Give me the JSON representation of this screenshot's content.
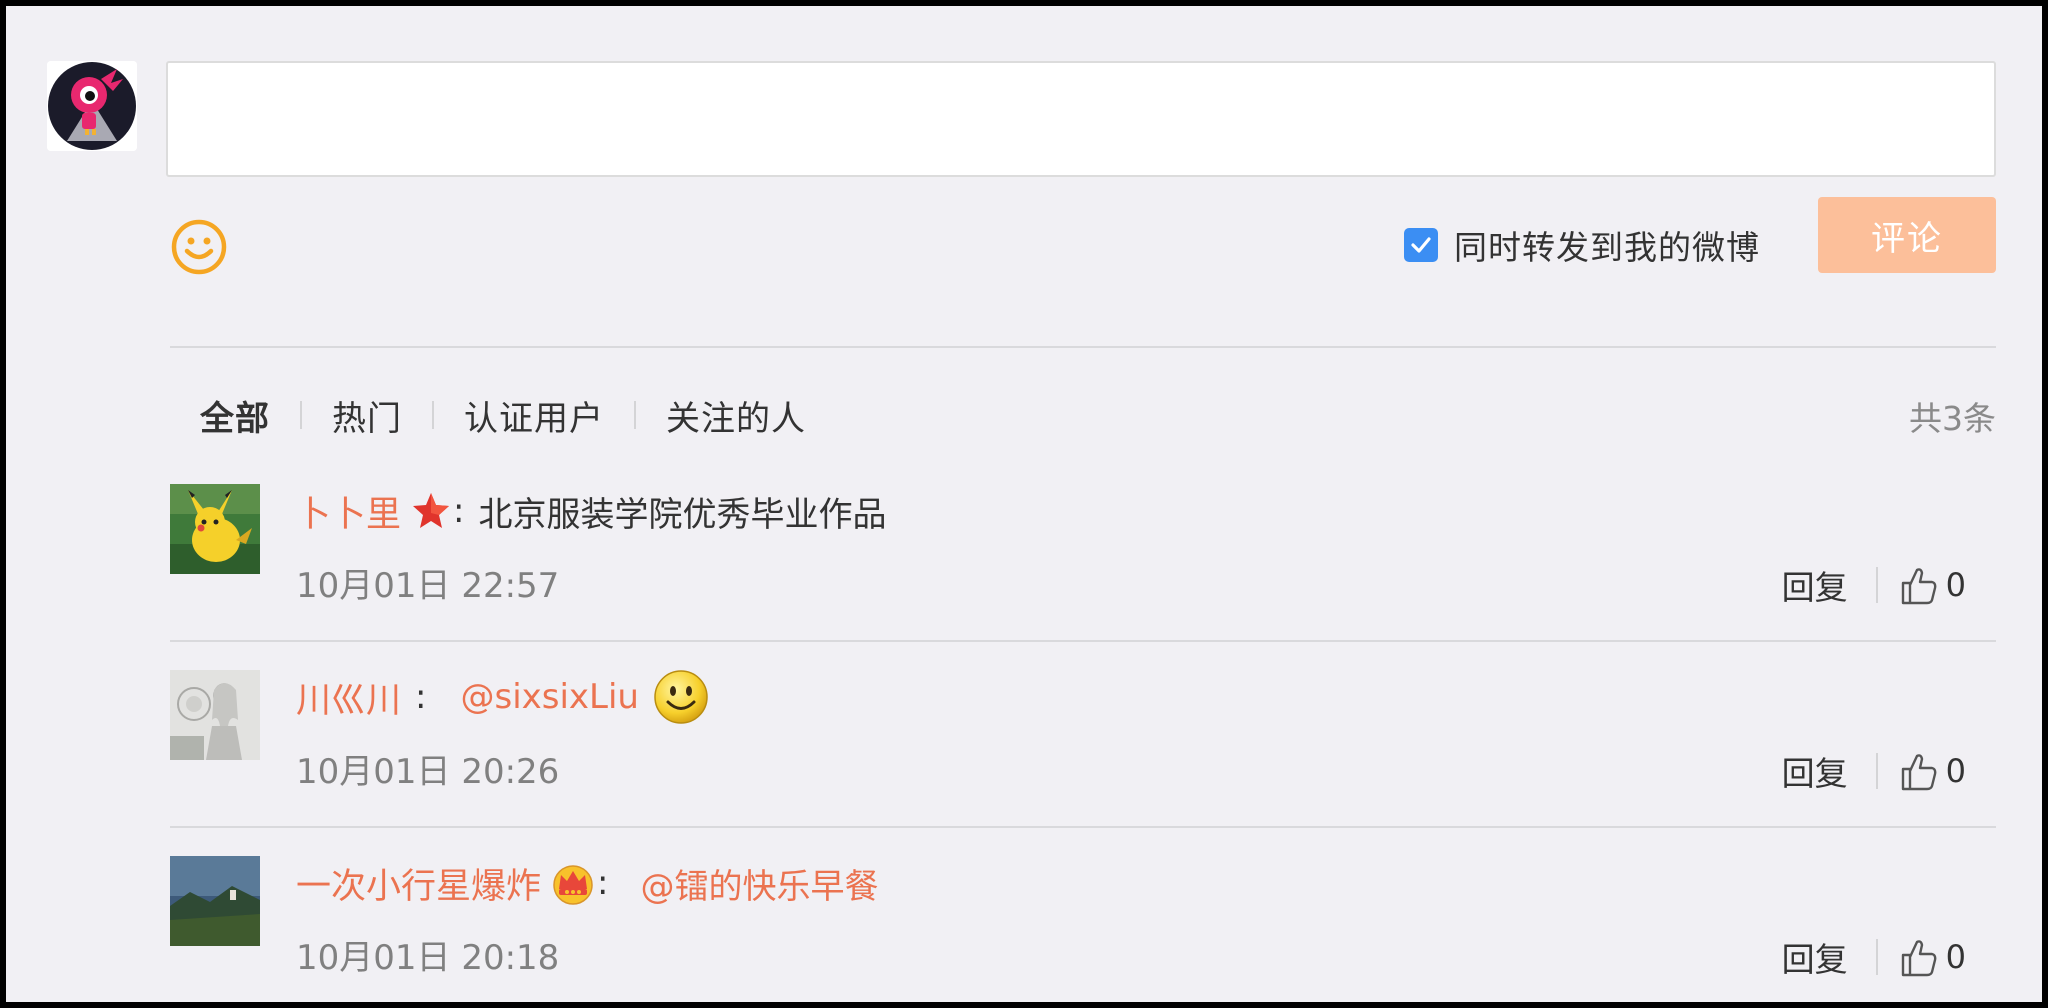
{
  "composer": {
    "placeholder": "",
    "forward_label": "同时转发到我的微博",
    "forward_checked": true,
    "submit_label": "评论",
    "submit_color": "#fcbf9a",
    "accent_color": "#eb7350",
    "emoji_icon": "smiley-icon"
  },
  "tabs": {
    "items": [
      {
        "label": "全部",
        "active": true
      },
      {
        "label": "热门",
        "active": false
      },
      {
        "label": "认证用户",
        "active": false
      },
      {
        "label": "关注的人",
        "active": false
      }
    ],
    "total": "共3条"
  },
  "comments": [
    {
      "username": "卜卜里",
      "badge": "star-icon",
      "colon": ":",
      "text": "北京服装学院优秀毕业作品",
      "mention": "",
      "time": "10月01日 22:57",
      "reply_label": "回复",
      "likes": "0"
    },
    {
      "username": "川巛川",
      "badge": "",
      "colon": ":",
      "text": "",
      "mention": "@sixsixLiu",
      "emoji": "smile-emoji-icon",
      "time": "10月01日 20:26",
      "reply_label": "回复",
      "likes": "0"
    },
    {
      "username": "一次小行星爆炸",
      "badge": "crown-icon",
      "colon": ":",
      "text": "",
      "mention": "@镭的快乐早餐",
      "time": "10月01日 20:18",
      "reply_label": "回复",
      "likes": "0"
    }
  ]
}
